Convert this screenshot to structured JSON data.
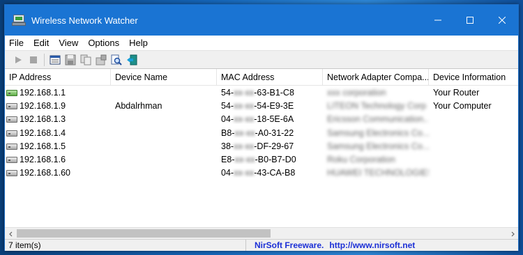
{
  "window": {
    "title": "Wireless Network Watcher"
  },
  "menu": [
    "File",
    "Edit",
    "View",
    "Options",
    "Help"
  ],
  "toolbar": {
    "buttons": [
      "play-icon",
      "stop-icon",
      "properties-icon",
      "save-icon",
      "copy-icon",
      "options-icon",
      "find-icon",
      "exit-icon"
    ]
  },
  "table": {
    "columns": [
      "IP Address",
      "Device Name",
      "MAC Address",
      "Network Adapter Compa...",
      "Device Information"
    ],
    "rows": [
      {
        "ip": "192.168.1.1",
        "name": "",
        "mac_start": "54-",
        "mac_hidden": "xx-xx",
        "mac_end": "-63-B1-C8",
        "vendor": "xxx corporation",
        "info": "Your Router",
        "icon": "router-icon"
      },
      {
        "ip": "192.168.1.9",
        "name": "Abdalrhman",
        "mac_start": "54-",
        "mac_hidden": "xx-xx",
        "mac_end": "-54-E9-3E",
        "vendor": "LITEON Technology Corp",
        "info": "Your Computer",
        "icon": "computer-icon"
      },
      {
        "ip": "192.168.1.3",
        "name": "",
        "mac_start": "04-",
        "mac_hidden": "xx-xx",
        "mac_end": "-18-5E-6A",
        "vendor": "Ericsson Communication...",
        "info": "",
        "icon": "device-icon"
      },
      {
        "ip": "192.168.1.4",
        "name": "",
        "mac_start": "B8-",
        "mac_hidden": "xx-xx",
        "mac_end": "-A0-31-22",
        "vendor": "Samsung Electronics Co...",
        "info": "",
        "icon": "device-icon"
      },
      {
        "ip": "192.168.1.5",
        "name": "",
        "mac_start": "38-",
        "mac_hidden": "xx-xx",
        "mac_end": "-DF-29-67",
        "vendor": "Samsung Electronics Co...",
        "info": "",
        "icon": "device-icon"
      },
      {
        "ip": "192.168.1.6",
        "name": "",
        "mac_start": "E8-",
        "mac_hidden": "xx-xx",
        "mac_end": "-B0-B7-D0",
        "vendor": "Roku Corporation",
        "info": "",
        "icon": "device-icon"
      },
      {
        "ip": "192.168.1.60",
        "name": "",
        "mac_start": "04-",
        "mac_hidden": "xx-xx",
        "mac_end": "-43-CA-B8",
        "vendor": "HUAWEI TECHNOLOGIES...",
        "info": "",
        "icon": "device-icon"
      }
    ]
  },
  "status": {
    "count": "7 item(s)",
    "link_label": "NirSoft Freeware.",
    "link_url": "http://www.nirsoft.net"
  },
  "colors": {
    "titlebar": "#1a74d3",
    "link": "#1b2fd6"
  }
}
